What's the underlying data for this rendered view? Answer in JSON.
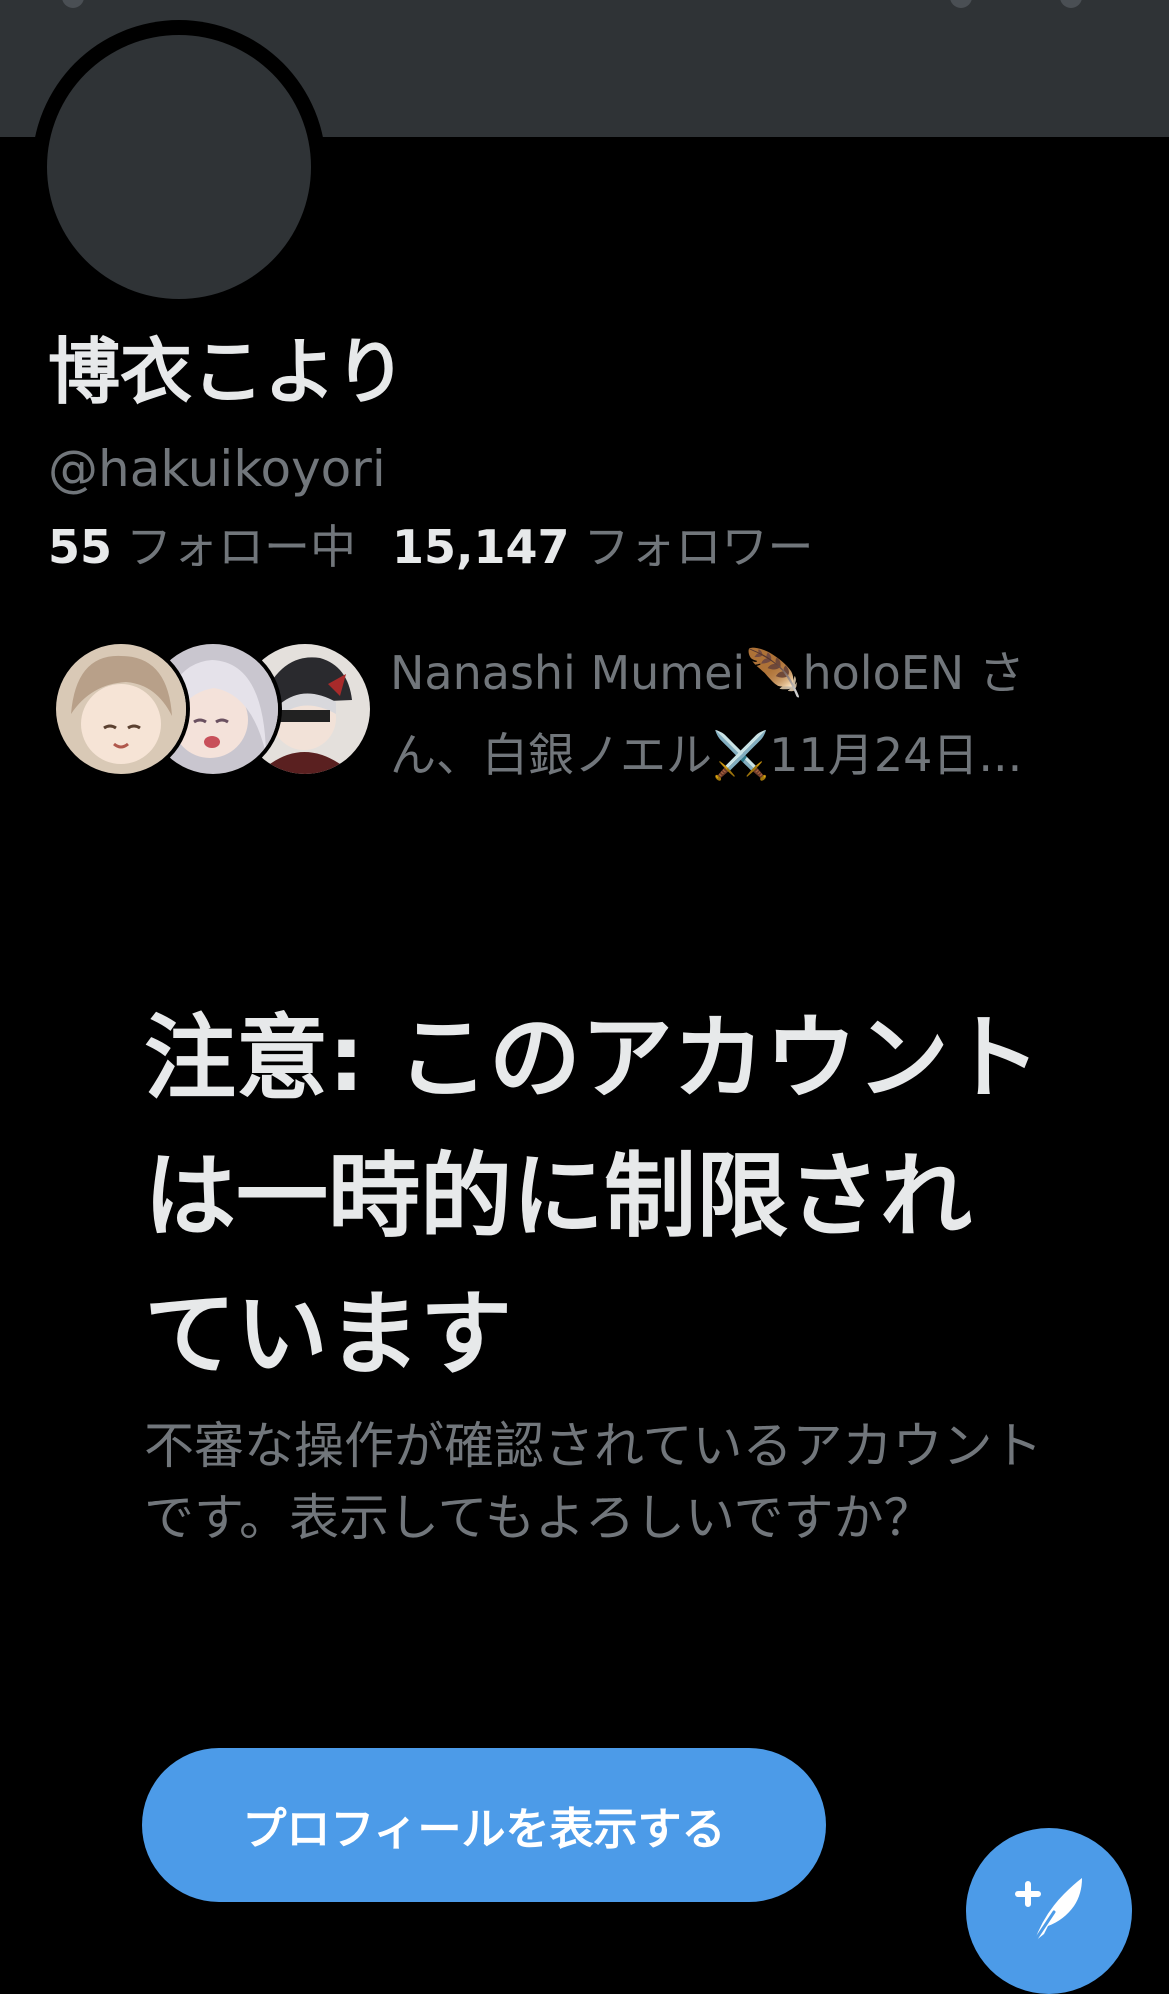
{
  "profile": {
    "display_name": "博衣こより",
    "handle": "@hakuikoyori",
    "following_count": "55",
    "following_label": "フォロー中",
    "followers_count": "15,147",
    "followers_label": "フォロワー"
  },
  "followed_by": {
    "text_line1": "Nanashi Mumei",
    "emoji1": "🪶",
    "text_line1b": "holoEN さ",
    "text_line2": "ん、白銀ノエル",
    "emoji2": "⚔️",
    "text_line2b": "11月24日..."
  },
  "warning": {
    "title": "注意: このアカウントは一時的に制限されています",
    "body": "不審な操作が確認されているアカウントです。表示してもよろしいですか？",
    "button_label": "プロフィールを表示する"
  },
  "colors": {
    "background": "#000000",
    "banner": "#2f3336",
    "accent": "#4c9be8",
    "primary_text": "#e7e9ea",
    "secondary_text": "#71767b"
  },
  "icons": {
    "compose": "compose-tweet-icon"
  }
}
